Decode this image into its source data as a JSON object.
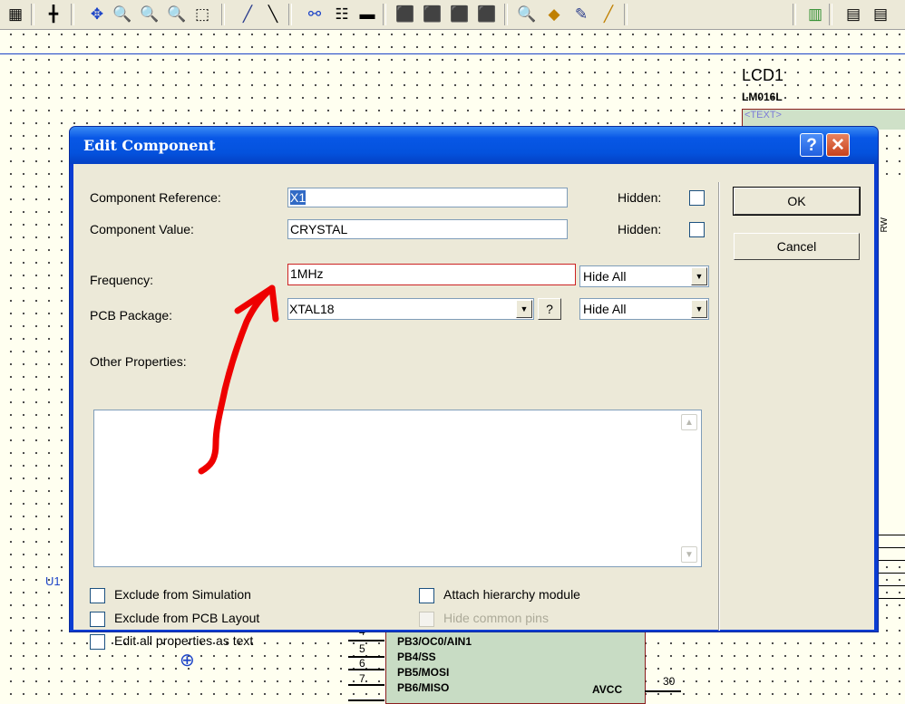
{
  "schematic": {
    "lcd_ref": "LCD1",
    "lcd_model": "LM016L",
    "lcd_text": "<TEXT>",
    "rw_label": "RW",
    "u_label": "U1",
    "pins": [
      {
        "num": "4",
        "name": "PB3/OC0/AIN1"
      },
      {
        "num": "5",
        "name": "PB4/SS"
      },
      {
        "num": "6",
        "name": "PB5/MOSI"
      },
      {
        "num": "7",
        "name": "PB6/MISO"
      }
    ],
    "avcc_label": "AVCC",
    "avcc_pin": "30"
  },
  "dialog": {
    "title": "Edit Component",
    "help_symbol": "?",
    "close_symbol": "✕",
    "component_reference": {
      "label": "Component Reference:",
      "value": "X1",
      "hidden_label": "Hidden:"
    },
    "component_value": {
      "label": "Component Value:",
      "value": "CRYSTAL",
      "hidden_label": "Hidden:"
    },
    "frequency": {
      "label": "Frequency:",
      "value": "1MHz",
      "visibility": "Hide All"
    },
    "pcb_package": {
      "label": "PCB Package:",
      "value": "XTAL18",
      "help_symbol": "?",
      "visibility": "Hide All"
    },
    "other_properties": {
      "label": "Other Properties:",
      "value": ""
    },
    "options": {
      "exclude_simulation": "Exclude from Simulation",
      "exclude_pcb": "Exclude from PCB Layout",
      "edit_as_text": "Edit all properties as text",
      "attach_hierarchy": "Attach hierarchy module",
      "hide_common_pins": "Hide common pins"
    },
    "buttons": {
      "ok": "OK",
      "cancel": "Cancel"
    }
  },
  "colors": {
    "titlebar": "#0452dd",
    "dialog_bg": "#ece9d8",
    "highlight": "#cc2222",
    "annotation_arrow": "#ee0000"
  }
}
